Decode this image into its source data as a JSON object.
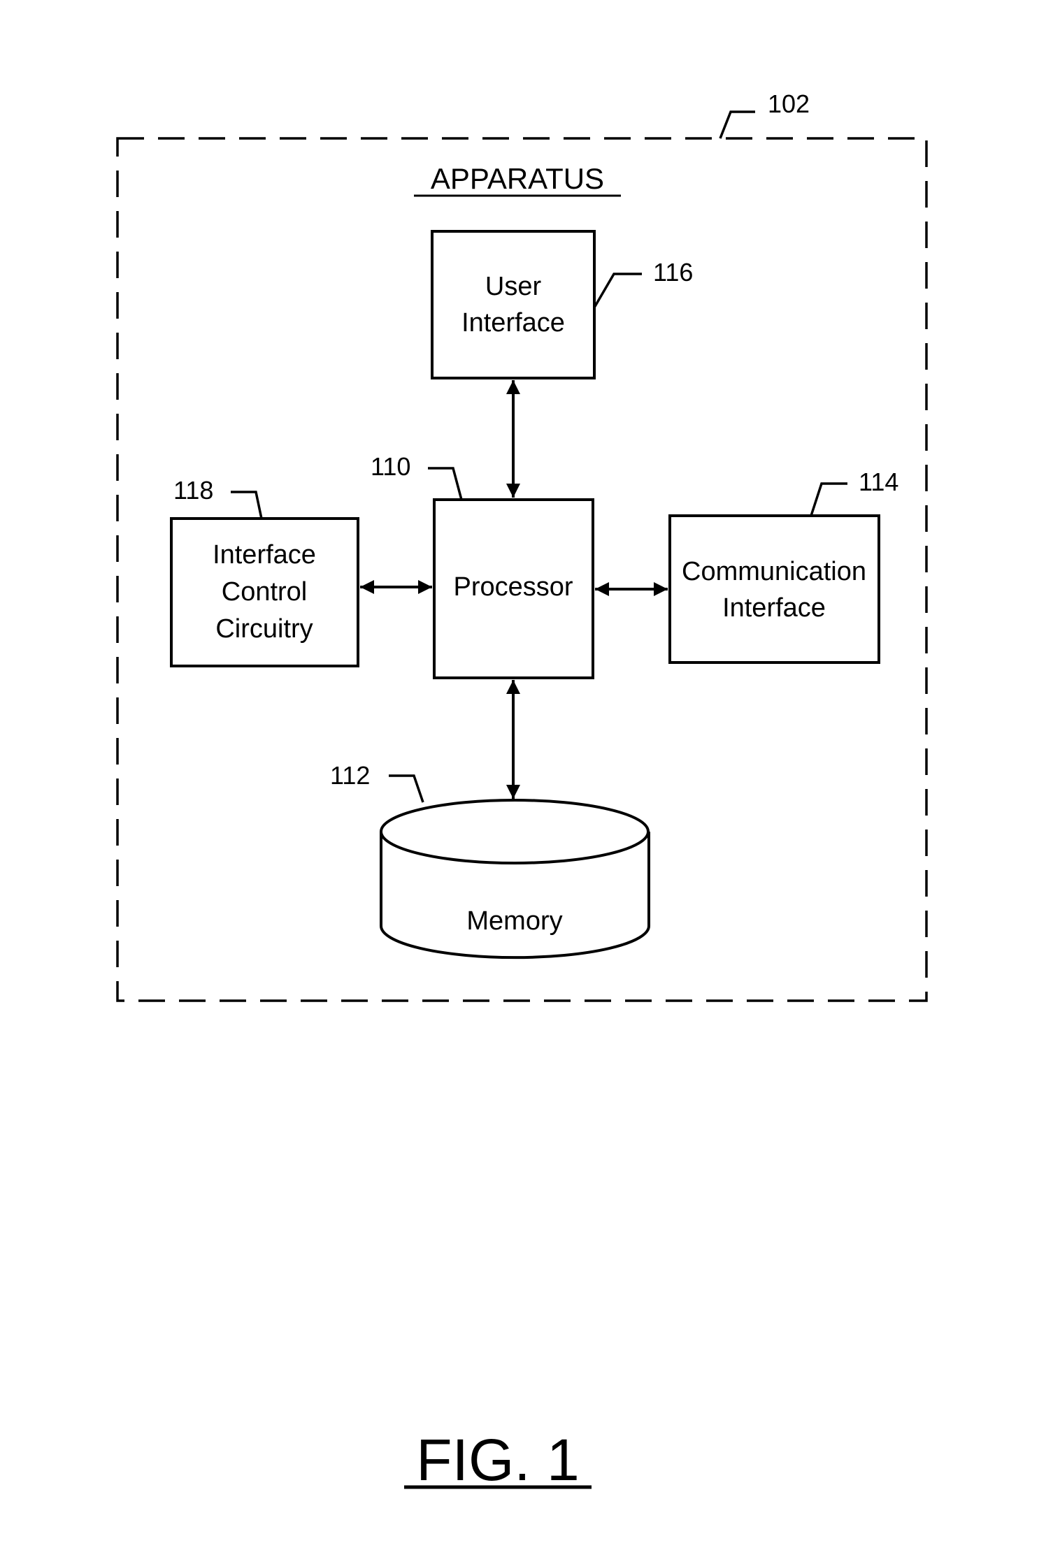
{
  "figure": {
    "caption": "FIG. 1",
    "title": "APPARATUS",
    "title_ref": "102"
  },
  "nodes": [
    {
      "id": "user-interface",
      "lines": [
        "User",
        "Interface"
      ],
      "ref": "116"
    },
    {
      "id": "processor",
      "lines": [
        "Processor"
      ],
      "ref": "110"
    },
    {
      "id": "interface-control-circuitry",
      "lines": [
        "Interface",
        "Control",
        "Circuitry"
      ],
      "ref": "118"
    },
    {
      "id": "communication-interface",
      "lines": [
        "Communication",
        "Interface"
      ],
      "ref": "114"
    },
    {
      "id": "memory",
      "lines": [
        "Memory"
      ],
      "ref": "112"
    }
  ],
  "edges": [
    {
      "from": "processor",
      "to": "user-interface",
      "bidirectional": true
    },
    {
      "from": "processor",
      "to": "interface-control-circuitry",
      "bidirectional": true
    },
    {
      "from": "processor",
      "to": "communication-interface",
      "bidirectional": true
    },
    {
      "from": "processor",
      "to": "memory",
      "bidirectional": true
    }
  ]
}
